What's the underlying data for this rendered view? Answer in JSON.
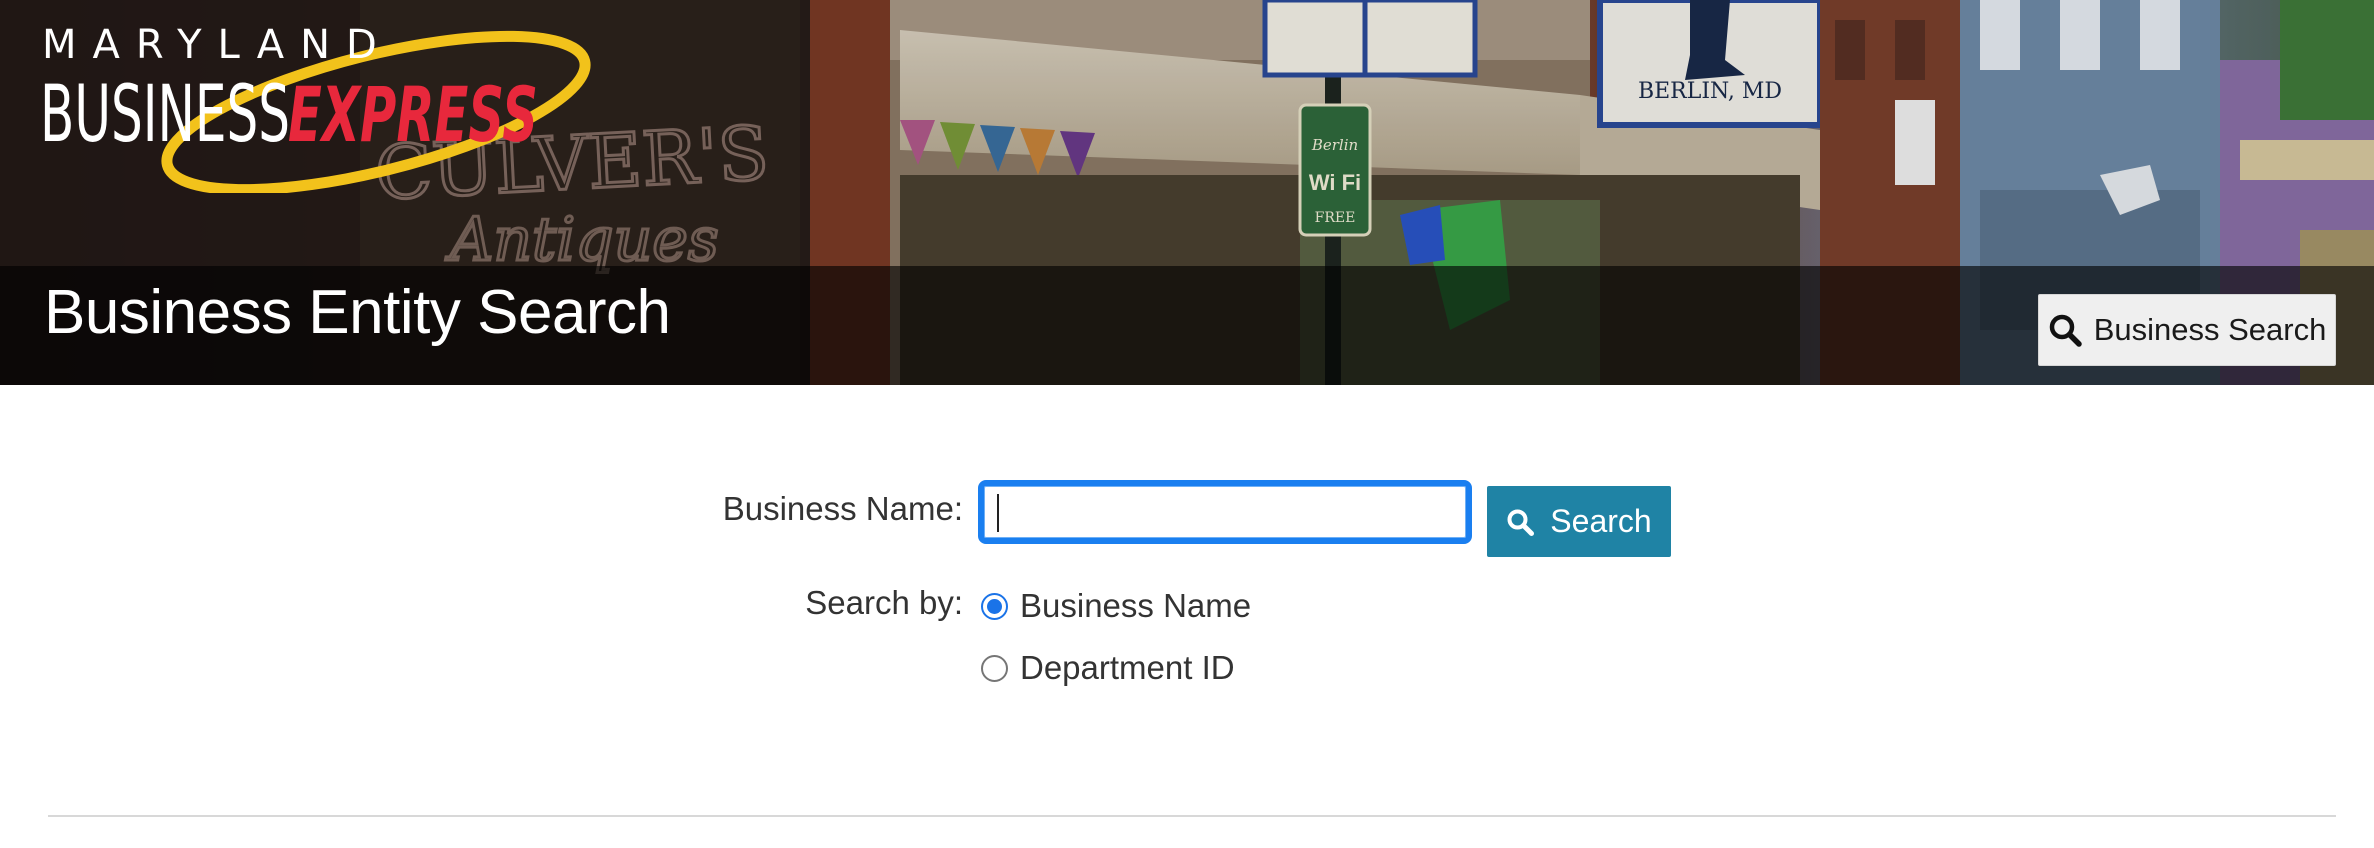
{
  "header": {
    "logo": {
      "line1": "MARYLAND",
      "line2_business": "BUSINESS",
      "line2_express": "EXPRESS"
    },
    "title": "Business Entity Search",
    "business_search_button": {
      "label": "Business Search",
      "icon": "search-icon"
    }
  },
  "hero_photo_signs": {
    "shop_sign": "CULVER'S",
    "shop_sign_sub": "Antiques",
    "berlin_sign": "BERLIN, MD",
    "wifi_sign_top": "Berlin",
    "wifi_sign_mid": "Wi Fi",
    "wifi_sign_bottom": "FREE"
  },
  "form": {
    "business_name_label": "Business Name:",
    "business_name_value": "",
    "search_button": {
      "label": "Search",
      "icon": "search-icon"
    },
    "search_by_label": "Search by:",
    "search_by_options": [
      {
        "label": "Business Name",
        "checked": true
      },
      {
        "label": "Department ID",
        "checked": false
      }
    ]
  },
  "colors": {
    "accent_blue": "#1f83a5",
    "focus_blue": "#1a7ff0",
    "radio_blue": "#1a73e8",
    "logo_red": "#e8283c",
    "logo_gold": "#f2c21b"
  }
}
